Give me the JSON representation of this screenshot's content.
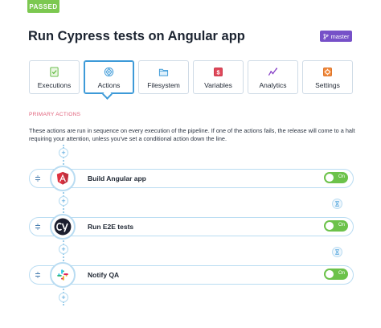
{
  "status": {
    "label": "PASSED",
    "color": "#7cc850"
  },
  "page": {
    "title": "Run Cypress tests on Angular app"
  },
  "branch": {
    "name": "master",
    "icon": "branch-icon",
    "color": "#7650c8"
  },
  "tabs": [
    {
      "label": "Executions",
      "icon": "executions-icon",
      "active": false
    },
    {
      "label": "Actions",
      "icon": "actions-icon",
      "active": true
    },
    {
      "label": "Filesystem",
      "icon": "filesystem-icon",
      "active": false
    },
    {
      "label": "Variables",
      "icon": "variables-icon",
      "active": false
    },
    {
      "label": "Analytics",
      "icon": "analytics-icon",
      "active": false
    },
    {
      "label": "Settings",
      "icon": "settings-icon",
      "active": false
    }
  ],
  "section": {
    "label": "PRIMARY ACTIONS",
    "description": "These actions are run in sequence on every execution of the pipeline. If one of the actions fails, the release will come to a halt requiring your attention, unless you've set a conditional action down the line."
  },
  "actions": [
    {
      "name": "Build Angular app",
      "logo": "angular-logo",
      "toggle": "On",
      "enabled": true
    },
    {
      "name": "Run E2E tests",
      "logo": "cypress-logo",
      "toggle": "On",
      "enabled": true
    },
    {
      "name": "Notify QA",
      "logo": "slack-logo",
      "toggle": "On",
      "enabled": true
    }
  ],
  "colors": {
    "accent": "#3d9ad8",
    "toggle_on": "#6cc24a",
    "section_label": "#e0607a"
  }
}
